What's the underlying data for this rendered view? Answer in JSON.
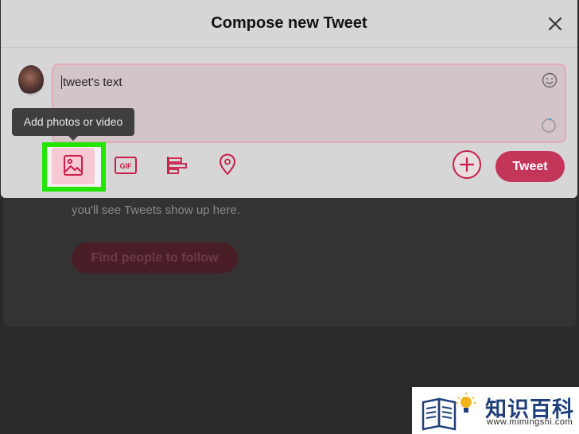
{
  "modal": {
    "title": "Compose new Tweet",
    "close_icon": "close-icon"
  },
  "composer": {
    "text_value": "tweet's text",
    "emoji_icon": "emoji-icon"
  },
  "tooltip": {
    "text": "Add photos or video"
  },
  "toolbar": {
    "tools": [
      {
        "name": "photo-icon",
        "label": "Add photos or video"
      },
      {
        "name": "gif-icon",
        "label": "GIF"
      },
      {
        "name": "poll-icon"
      },
      {
        "name": "location-icon"
      }
    ],
    "gif_text": "GIF",
    "tweet_button": "Tweet"
  },
  "background": {
    "empty_text": "you'll see Tweets show up here.",
    "find_people_button": "Find people to follow"
  },
  "watermark": {
    "brand": "知识百科",
    "url": "www.mimingshi.com"
  },
  "colors": {
    "accent": "#c4355a",
    "highlight": "#22e600"
  }
}
